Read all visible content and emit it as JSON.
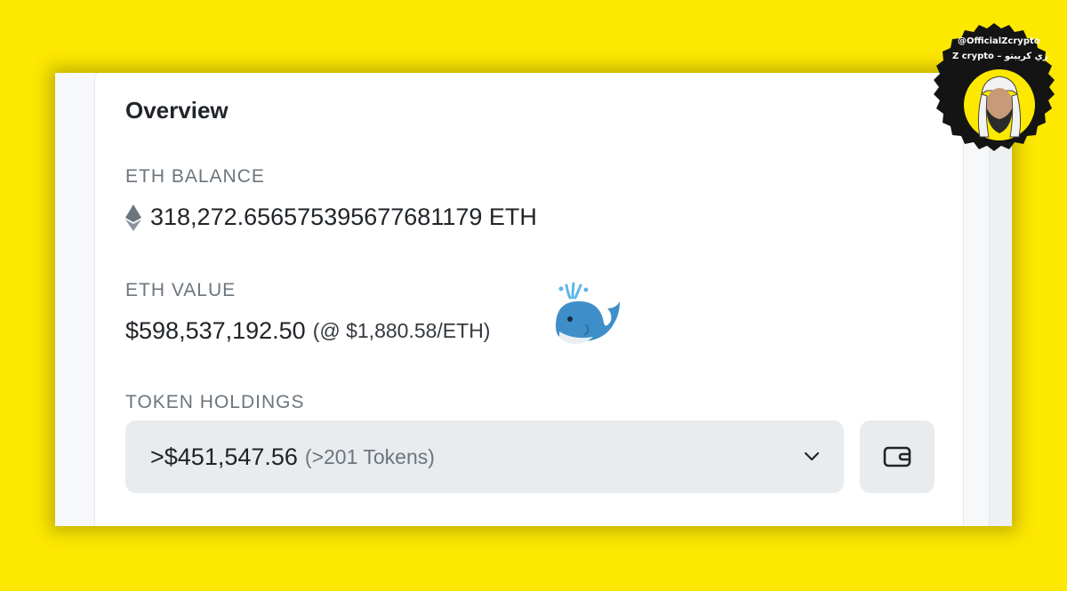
{
  "overview": {
    "title": "Overview",
    "eth_balance_label": "ETH BALANCE",
    "eth_balance": "318,272.656575395677681179 ETH",
    "eth_value_label": "ETH VALUE",
    "eth_value": "$598,537,192.50",
    "eth_price": "(@ $1,880.58/ETH)",
    "token_holdings_label": "TOKEN HOLDINGS",
    "token_holdings_value": ">$451,547.56",
    "token_holdings_count": "(>201 Tokens)"
  },
  "icons": {
    "eth": "ethereum-icon",
    "whale": "whale-emoji",
    "chevron": "chevron-down-icon",
    "wallet": "wallet-icon"
  },
  "watermark": {
    "handle": "@OfficialZcrypto",
    "name": "Z crypto – زي كريبتو"
  },
  "colors": {
    "background": "#fde800",
    "card": "#ffffff",
    "select_bg": "#e9ecef",
    "text": "#212529",
    "muted": "#6c757d"
  }
}
